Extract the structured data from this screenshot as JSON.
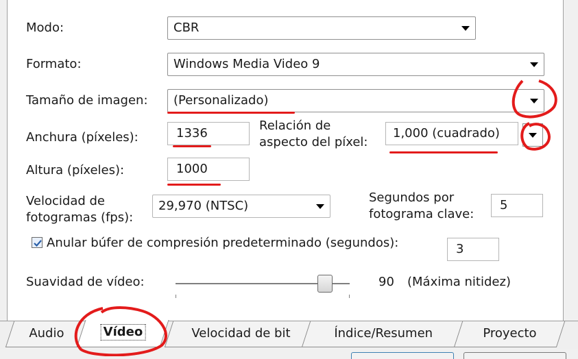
{
  "form": {
    "modo": {
      "label": "Modo:",
      "value": "CBR"
    },
    "formato": {
      "label": "Formato:",
      "value": "Windows Media Video 9"
    },
    "tamano": {
      "label": "Tamaño de imagen:",
      "value": "(Personalizado)"
    },
    "anchura": {
      "label": "Anchura (píxeles):",
      "value": "1336"
    },
    "relacion": {
      "label_line1": "Relación de",
      "label_line2": "aspecto del píxel:",
      "value": "1,000 (cuadrado)"
    },
    "altura": {
      "label": "Altura (píxeles):",
      "value": "1000"
    },
    "velocidad": {
      "label_line1": "Velocidad de",
      "label_line2": "fotogramas (fps):",
      "value": "29,970 (NTSC)"
    },
    "segundos": {
      "label_line1": "Segundos por",
      "label_line2": "fotograma clave:",
      "value": "5"
    },
    "anular": {
      "label": "Anular búfer de compresión predeterminado (segundos):",
      "checked": true,
      "value": "3"
    },
    "suavidad": {
      "label": "Suavidad de vídeo:",
      "value": "90",
      "level": 90,
      "description": "(Máxima nitidez)"
    }
  },
  "tabs": [
    {
      "label": "Audio",
      "active": false
    },
    {
      "label": "Vídeo",
      "active": true
    },
    {
      "label": "Velocidad de bit",
      "active": false
    },
    {
      "label": "Índice/Resumen",
      "active": false
    },
    {
      "label": "Proyecto",
      "active": false
    }
  ],
  "annotation_color": "#e31b1b"
}
